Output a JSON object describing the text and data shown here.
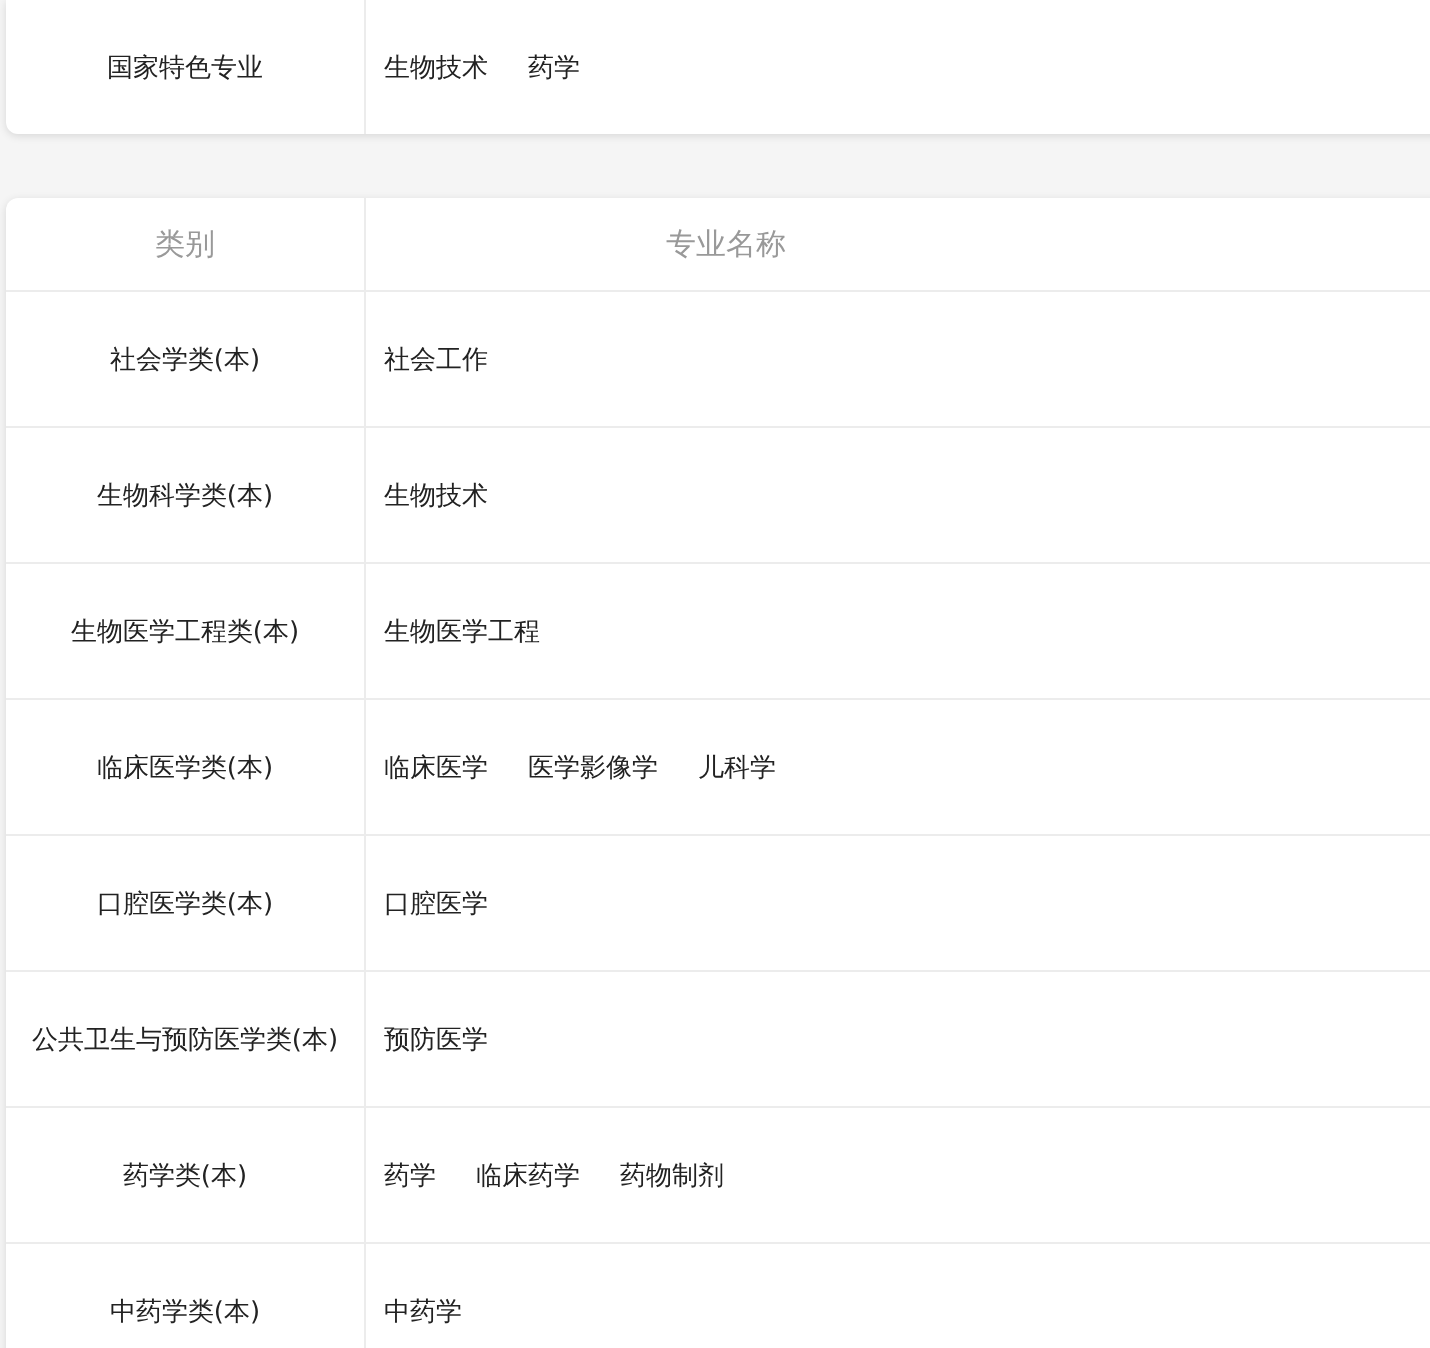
{
  "featured": {
    "label": "国家特色专业",
    "majors": [
      "生物技术",
      "药学"
    ]
  },
  "table": {
    "columns": [
      "类别",
      "专业名称"
    ],
    "rows": [
      {
        "category": "社会学类(本)",
        "majors": [
          "社会工作"
        ]
      },
      {
        "category": "生物科学类(本)",
        "majors": [
          "生物技术"
        ]
      },
      {
        "category": "生物医学工程类(本)",
        "majors": [
          "生物医学工程"
        ]
      },
      {
        "category": "临床医学类(本)",
        "majors": [
          "临床医学",
          "医学影像学",
          "儿科学"
        ]
      },
      {
        "category": "口腔医学类(本)",
        "majors": [
          "口腔医学"
        ]
      },
      {
        "category": "公共卫生与预防医学类(本)",
        "majors": [
          "预防医学"
        ]
      },
      {
        "category": "药学类(本)",
        "majors": [
          "药学",
          "临床药学",
          "药物制剂"
        ]
      },
      {
        "category": "中药学类(本)",
        "majors": [
          "中药学"
        ]
      }
    ]
  }
}
